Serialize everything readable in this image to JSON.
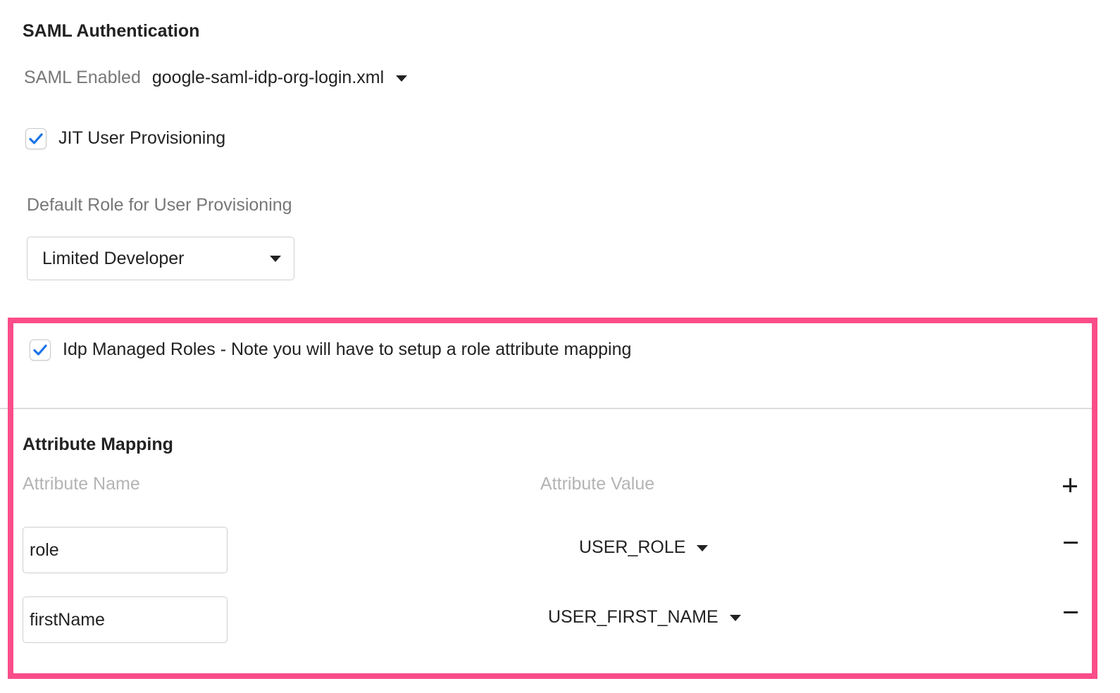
{
  "saml": {
    "title": "SAML Authentication",
    "enabled_label": "SAML Enabled",
    "idp_file": "google-saml-idp-org-login.xml"
  },
  "jit": {
    "label": "JIT User Provisioning",
    "checked": true
  },
  "default_role": {
    "label": "Default Role for User Provisioning",
    "value": "Limited Developer"
  },
  "idp_managed": {
    "label": "Idp Managed Roles - Note you will have to setup a role attribute mapping",
    "checked": true
  },
  "attribute_mapping": {
    "title": "Attribute Mapping",
    "col_name": "Attribute Name",
    "col_value": "Attribute Value",
    "rows": [
      {
        "name": "role",
        "value": "USER_ROLE"
      },
      {
        "name": "firstName",
        "value": "USER_FIRST_NAME"
      }
    ]
  },
  "colors": {
    "highlight": "#fa4d89",
    "check_accent": "#1a73e8"
  },
  "icons": {
    "add": "plus-icon",
    "remove": "minus-icon",
    "dropdown": "caret-down-icon",
    "check": "checkmark-icon"
  }
}
